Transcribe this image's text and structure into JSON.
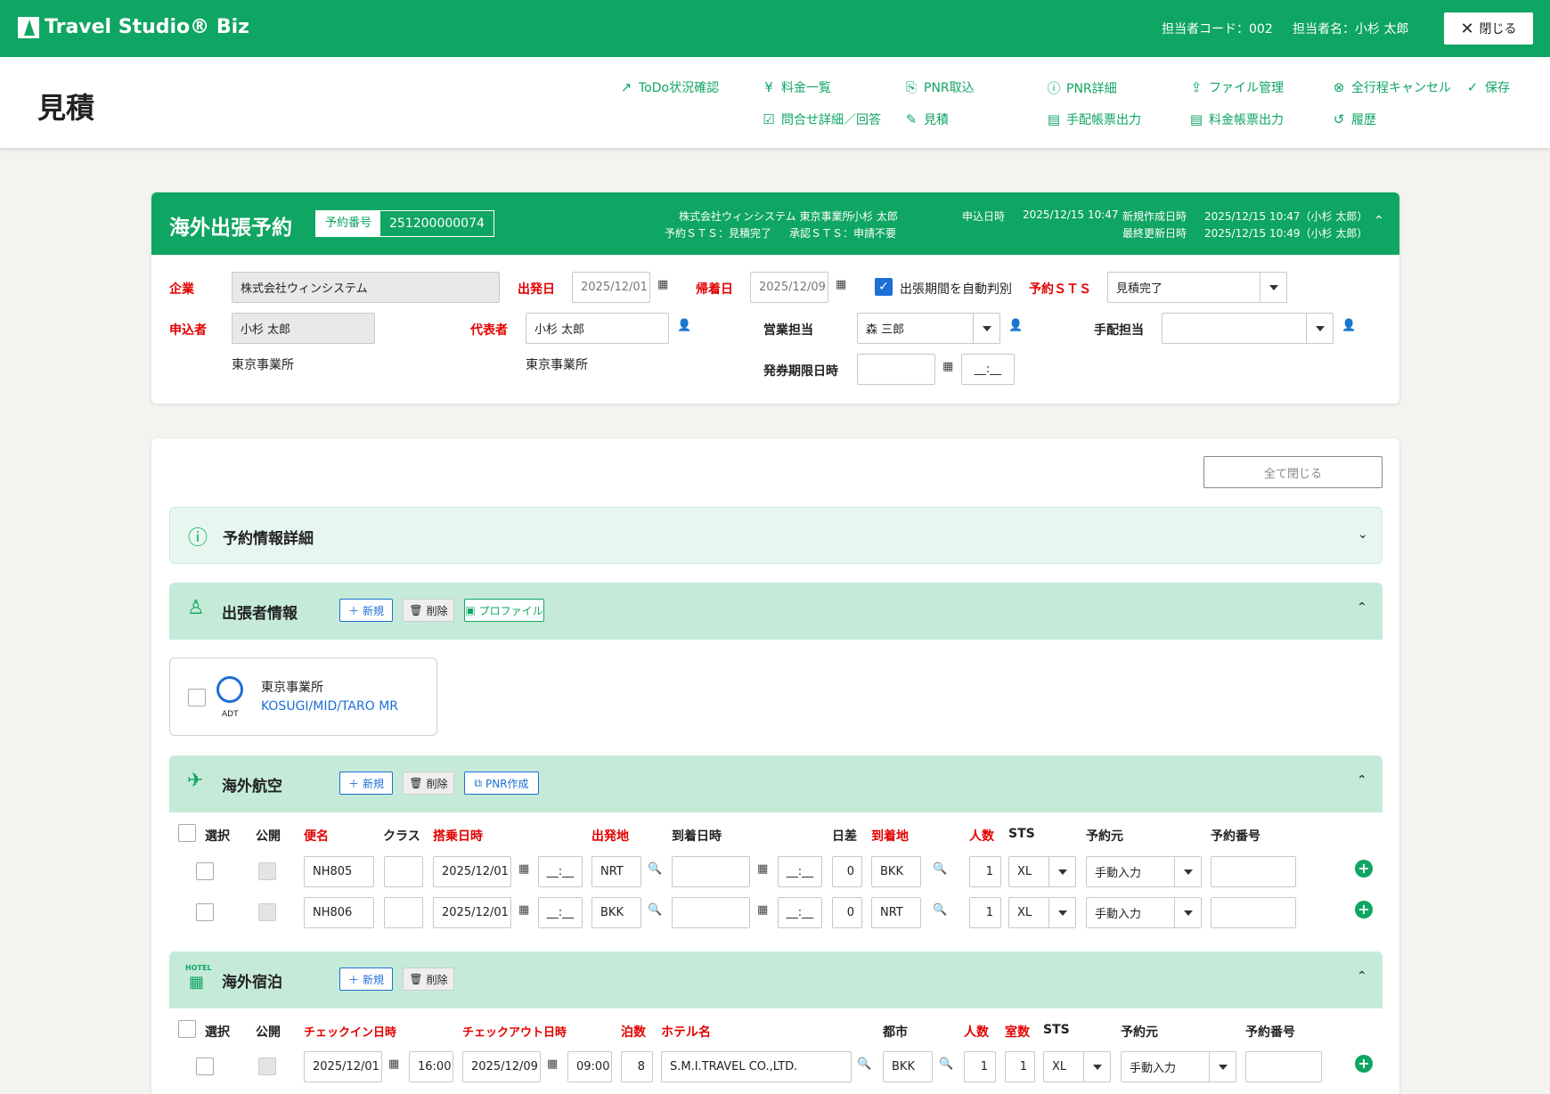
{
  "app": {
    "brand": "Travel Studio® Biz",
    "close_label": "閉じる"
  },
  "user": {
    "code_text": "担当者コード：002",
    "name_text": "担当者名：小杉 太郎"
  },
  "page": {
    "title": "見積"
  },
  "toolbar": {
    "todo": "ToDo状況確認",
    "fare_list": "料金一覧",
    "pnr_import": "PNR取込",
    "pnr_detail": "PNR詳細",
    "file_mgmt": "ファイル管理",
    "cancel_all": "全行程キャンセル",
    "save": "保存",
    "inquiry": "問合せ詳細／回答",
    "estimate": "見積",
    "arrange_out": "手配帳票出力",
    "fare_out": "料金帳票出力",
    "history": "履歴"
  },
  "booking": {
    "title": "海外出張予約",
    "no_label": "予約番号",
    "no_value": "251200000074",
    "company_office": "株式会社ウィンシステム 東京事業所",
    "person": "小杉 太郎",
    "sts_text": "予約ＳＴＳ：見積完了",
    "approval_text": "承認ＳＴＳ：申請不要",
    "applied_label": "申込日時",
    "applied_value": "2025/12/15 10:47",
    "created_label": "新規作成日時",
    "created_value": "2025/12/15 10:47（小杉 太郎）",
    "updated_label": "最終更新日時",
    "updated_value": "2025/12/15 10:49（小杉 太郎）"
  },
  "form": {
    "company_label": "企業",
    "company_value": "株式会社ウィンシステム",
    "depart_label": "出発日",
    "depart_value": "2025/12/01",
    "return_label": "帰着日",
    "return_value": "2025/12/09",
    "auto_judge_label": "出張期間を自動判別",
    "resv_sts_label": "予約ＳＴＳ",
    "resv_sts_value": "見積完了",
    "applicant_label": "申込者",
    "applicant_value": "小杉 太郎",
    "applicant_office": "東京事業所",
    "rep_label": "代表者",
    "rep_value": "小杉 太郎",
    "rep_office": "東京事業所",
    "sales_label": "営業担当",
    "sales_value": "森 三郎",
    "arranger_label": "手配担当",
    "arranger_value": "",
    "ticket_deadline_label": "発券期限日時",
    "ticket_deadline_date": "",
    "ticket_deadline_time": "__:__"
  },
  "detail": {
    "close_all": "全て閉じる",
    "info_title": "予約情報詳細",
    "travelers_title": "出張者情報",
    "btn_new": "新規",
    "btn_delete": "削除",
    "btn_profile": "プロファイル",
    "btn_pnr": "PNR作成",
    "traveler": {
      "type": "ADT",
      "office": "東京事業所",
      "name": "KOSUGI/MID/TARO MR"
    },
    "air_title": "海外航空",
    "hotel_title": "海外宿泊",
    "hotel_badge": "HOTEL"
  },
  "air": {
    "headers": [
      "選択",
      "公開",
      "便名",
      "クラス",
      "搭乗日時",
      "出発地",
      "到着日時",
      "日差",
      "到着地",
      "人数",
      "STS",
      "予約元",
      "予約番号"
    ],
    "rows": [
      {
        "flight": "NH805",
        "class": "",
        "date": "2025/12/01",
        "time": "__:__",
        "from": "NRT",
        "arr_date": "",
        "arr_time": "__:__",
        "diff": "0",
        "to": "BKK",
        "pax": "1",
        "sts": "XL",
        "source": "手動入力",
        "resv_no": ""
      },
      {
        "flight": "NH806",
        "class": "",
        "date": "2025/12/01",
        "time": "__:__",
        "from": "BKK",
        "arr_date": "",
        "arr_time": "__:__",
        "diff": "0",
        "to": "NRT",
        "pax": "1",
        "sts": "XL",
        "source": "手動入力",
        "resv_no": ""
      }
    ]
  },
  "hotel": {
    "headers": [
      "選択",
      "公開",
      "チェックイン日時",
      "チェックアウト日時",
      "泊数",
      "ホテル名",
      "都市",
      "人数",
      "室数",
      "STS",
      "予約元",
      "予約番号"
    ],
    "rows": [
      {
        "in_date": "2025/12/01",
        "in_time": "16:00",
        "out_date": "2025/12/09",
        "out_time": "09:00",
        "nights": "8",
        "name": "S.M.I.TRAVEL CO.,LTD.",
        "city": "BKK",
        "pax": "1",
        "rooms": "1",
        "sts": "XL",
        "source": "手動入力",
        "resv_no": ""
      }
    ]
  },
  "colors": {
    "brand": "#0fa562",
    "required": "#e30000",
    "link": "#1d6fd6"
  }
}
